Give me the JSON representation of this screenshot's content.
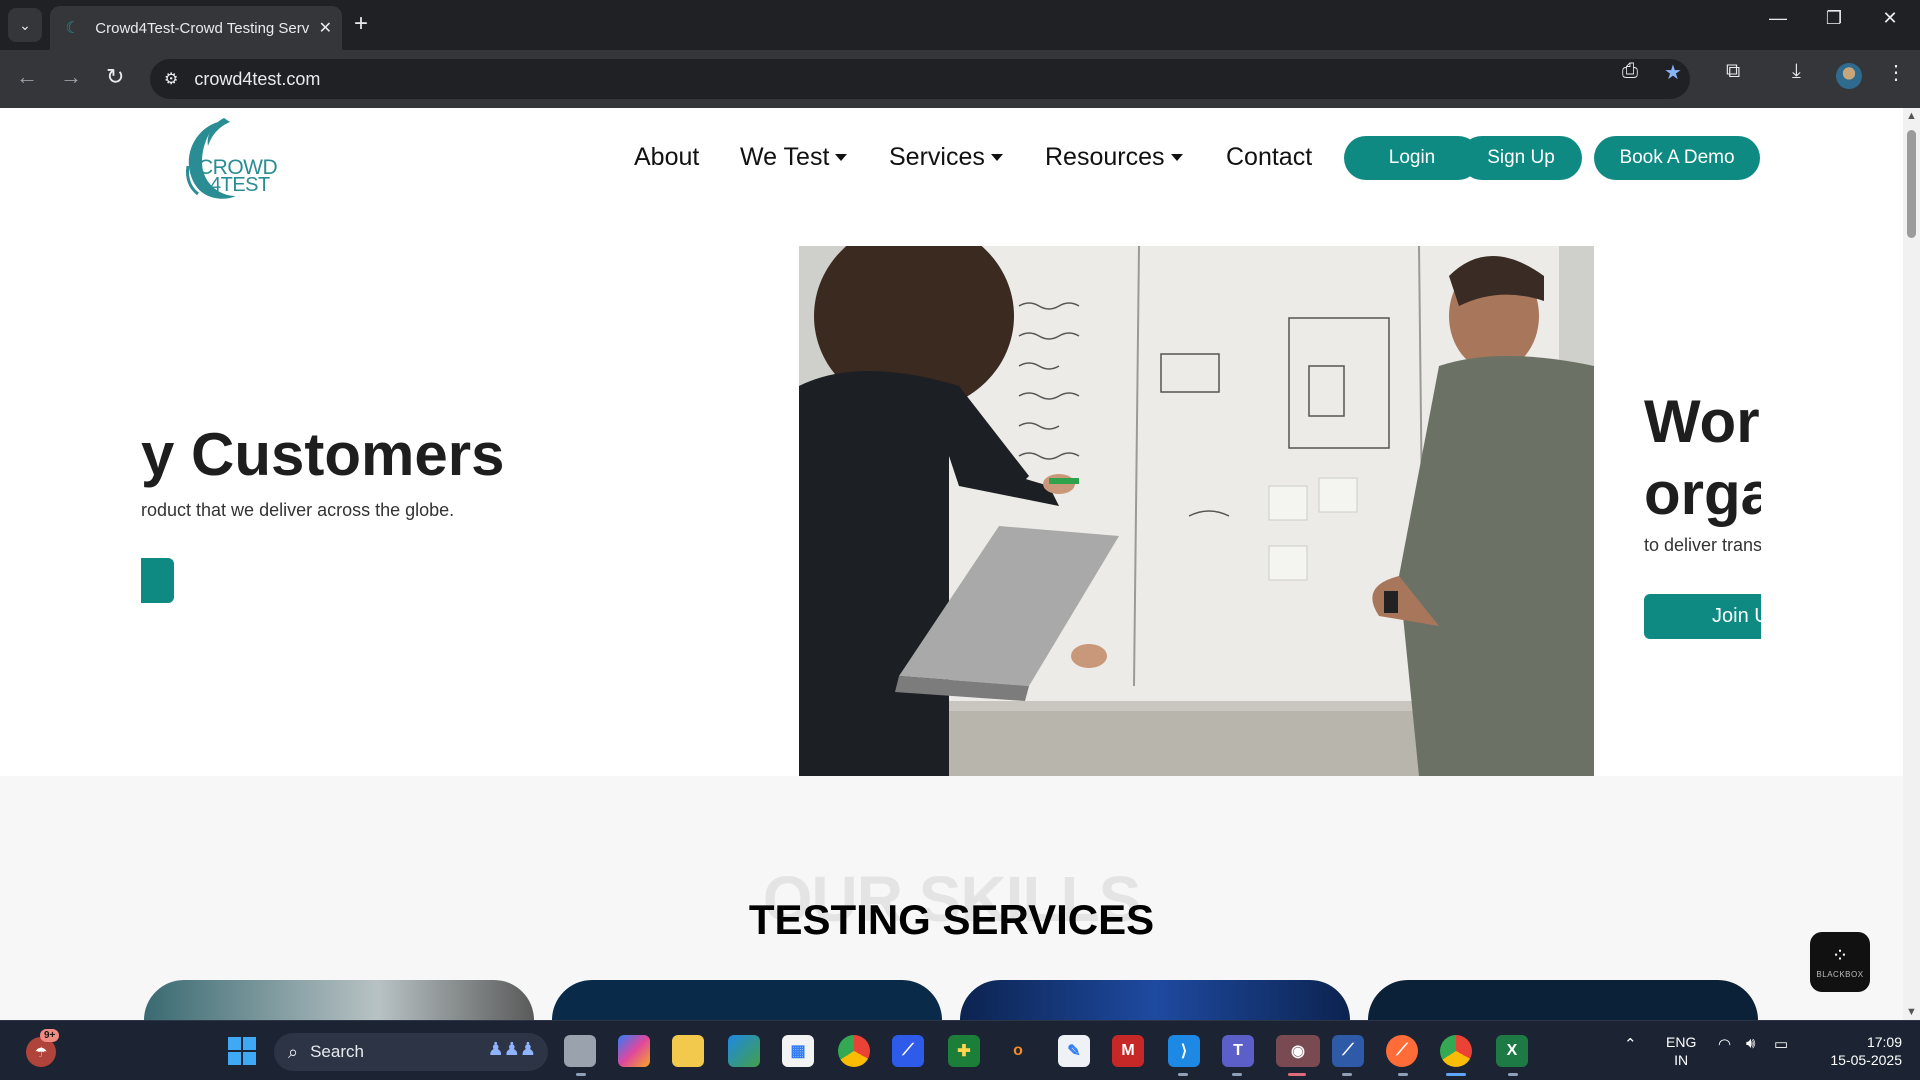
{
  "browser": {
    "tab_title": "Crowd4Test-Crowd Testing Serv",
    "url": "crowd4test.com"
  },
  "site": {
    "logo": {
      "line1": "CROWD",
      "line2": "4TEST"
    },
    "nav": [
      {
        "label": "About",
        "dropdown": false
      },
      {
        "label": "We Test",
        "dropdown": true
      },
      {
        "label": "Services",
        "dropdown": true
      },
      {
        "label": "Resources",
        "dropdown": true
      },
      {
        "label": "Contact",
        "dropdown": false
      }
    ],
    "buttons": {
      "login": "Login",
      "signup": "Sign Up",
      "demo": "Book A Demo"
    },
    "hero": {
      "left_title": "y Customers",
      "left_sub": "roduct that we deliver across the globe.",
      "right_title_1": "Wor",
      "right_title_2": "orga",
      "right_sub": "to deliver transp",
      "right_button": "Join U"
    },
    "skills": {
      "background_word": "OUR SKILLS",
      "heading": "TESTING SERVICES"
    },
    "widget": {
      "label": "BLACKBOX"
    }
  },
  "taskbar": {
    "notification_count": "9+",
    "search_placeholder": "Search",
    "language": [
      "ENG",
      "IN"
    ],
    "time": "17:09",
    "date": "15-05-2025"
  },
  "colors": {
    "brand_teal": "#0e8a83",
    "chrome_dark": "#202124",
    "chrome_toolbar": "#35363a",
    "taskbar": "#1c2433"
  },
  "icons": [
    "tab-search-icon",
    "site-favicon",
    "close-icon",
    "plus-icon",
    "minimize-icon",
    "restore-icon",
    "window-close-icon",
    "back-icon",
    "forward-icon",
    "reload-icon",
    "site-info-icon",
    "install-app-icon",
    "bookmark-star-icon",
    "extensions-icon",
    "download-icon",
    "profile-avatar"
  ]
}
